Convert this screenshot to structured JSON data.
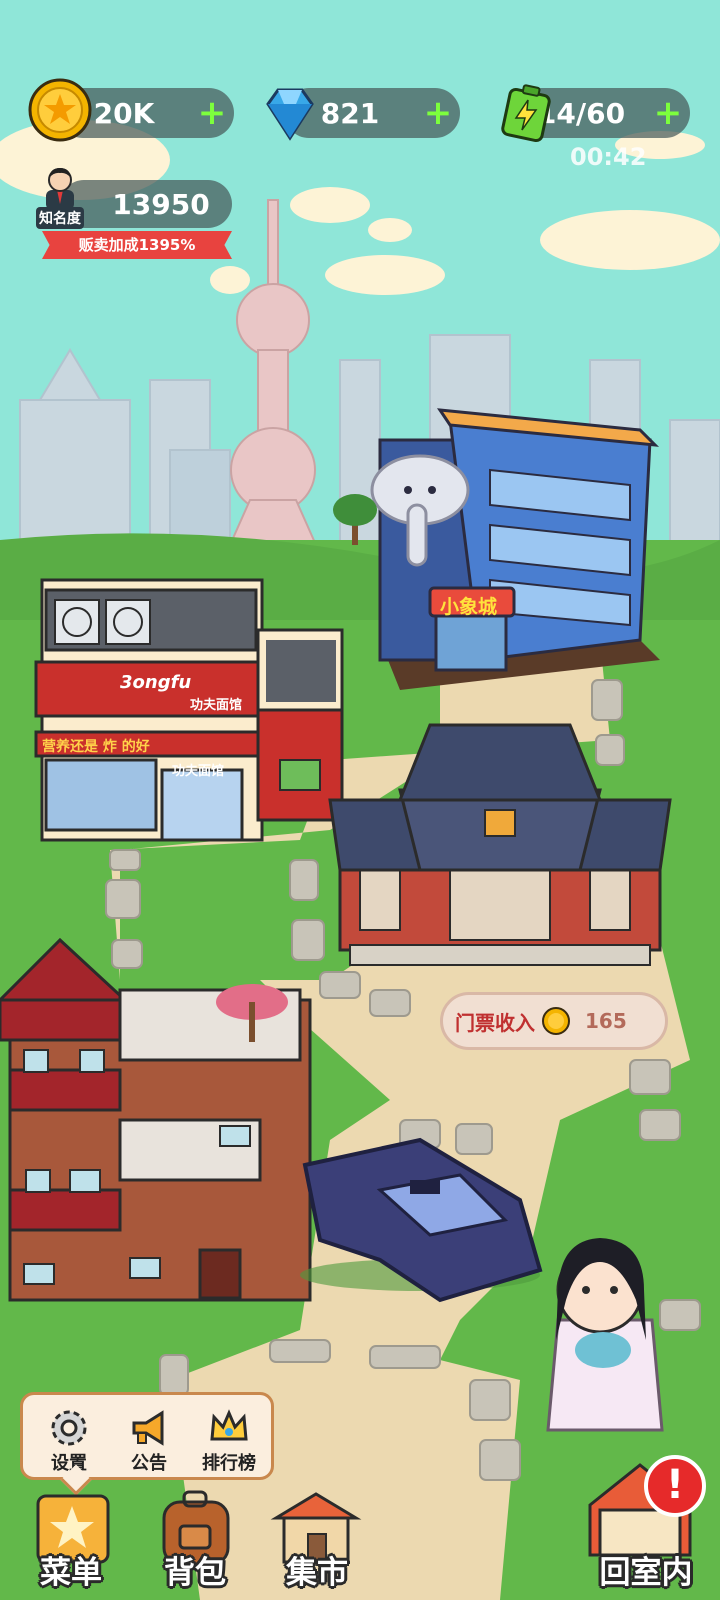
{
  "hud": {
    "coins": "20K",
    "gems": "821",
    "energy": "14/60",
    "energy_timer": "00:42",
    "plus_label": "+",
    "icons": {
      "coin": "coin-star-icon",
      "gem": "diamond-icon",
      "energy": "battery-icon"
    }
  },
  "fame": {
    "label": "知名度",
    "value": "13950",
    "bonus_text": "贩卖加成1395%"
  },
  "buildings": {
    "mall_sign": "小象城",
    "restaurant_sign_top": "功夫面馆",
    "restaurant_sign_bottom": "功夫面馆",
    "restaurant_slogan": "营养还是 炸 的好",
    "restaurant_logo": "3ongfu"
  },
  "ticket": {
    "label": "门票收入",
    "amount": "165"
  },
  "menu_popup": {
    "items": [
      {
        "label": "设置",
        "icon": "gear-icon"
      },
      {
        "label": "公告",
        "icon": "megaphone-icon"
      },
      {
        "label": "排行榜",
        "icon": "crown-icon"
      }
    ]
  },
  "bottom_bar": {
    "menu": "菜单",
    "bag": "背包",
    "market": "集市",
    "home": "回室内",
    "alert": "!"
  },
  "colors": {
    "sky": "#8fe6d8",
    "grass": "#62b84a",
    "path": "#ecd9b0",
    "pill_bg": "#46605a",
    "plus": "#7dff3d",
    "bonus": "#e8433f"
  }
}
